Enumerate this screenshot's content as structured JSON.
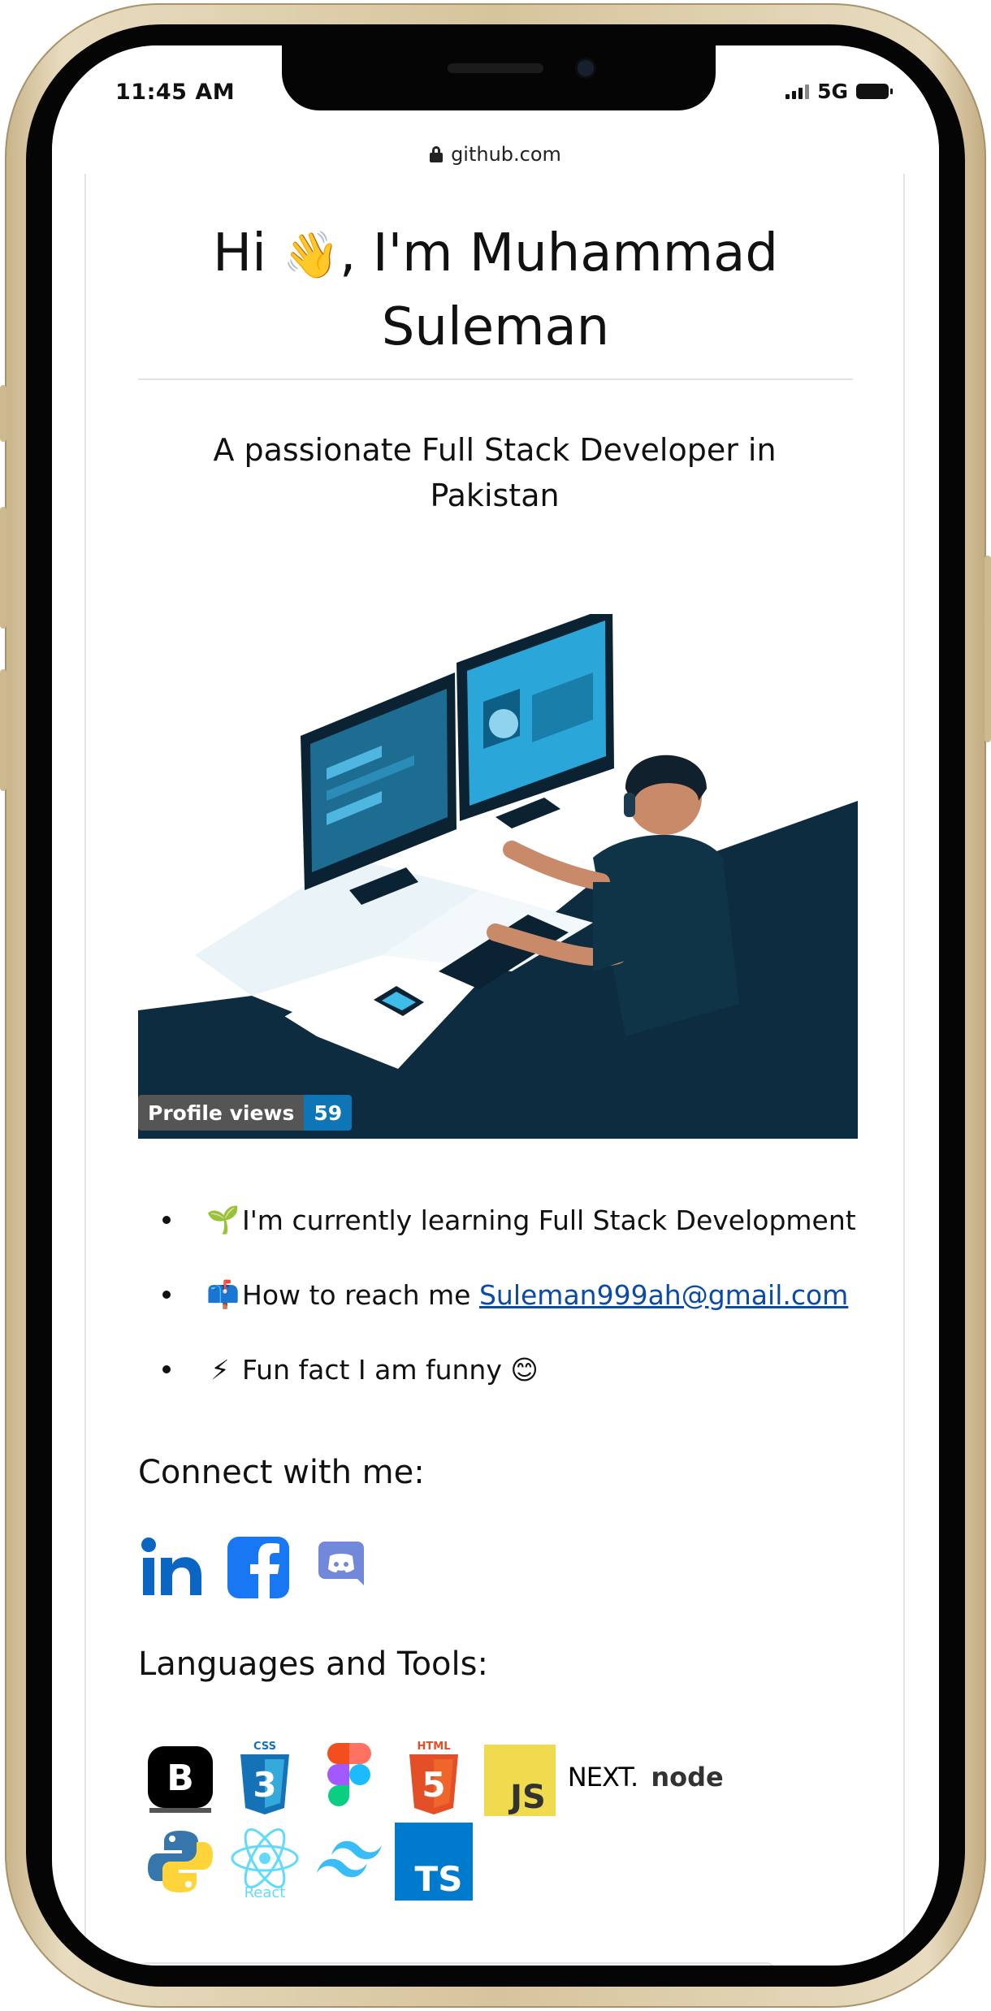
{
  "status": {
    "time": "11:45 AM",
    "network": "5G"
  },
  "browser": {
    "url": "github.com"
  },
  "profile": {
    "title_pre": "Hi ",
    "title_emoji": "👋",
    "title_post": ", I'm Muhammad Suleman",
    "subtitle": "A passionate Full Stack Developer in Pakistan"
  },
  "badge": {
    "label": "Profile views",
    "value": "59"
  },
  "facts": [
    {
      "emoji": "🌱",
      "text": "I'm currently learning Full Stack Development"
    },
    {
      "emoji": "📫",
      "text": "How to reach me ",
      "link": "Suleman999ah@gmail.com"
    },
    {
      "emoji": "⚡",
      "text": "Fun fact I am funny ",
      "emoji_after": "😊"
    }
  ],
  "connect": {
    "heading": "Connect with me:",
    "icons": [
      "linkedin-icon",
      "facebook-icon",
      "discord-icon"
    ]
  },
  "tools": {
    "heading": "Languages and Tools:",
    "icons": [
      "bootstrap-icon",
      "css3-icon",
      "figma-icon",
      "html5-icon",
      "javascript-icon",
      "nextjs-icon",
      "nodejs-icon",
      "python-icon",
      "react-icon",
      "tailwind-icon",
      "typescript-icon"
    ],
    "nextjs_text": "NEXT.",
    "node_text": "node",
    "js_text": "JS",
    "ts_text": "TS",
    "react_text": "React",
    "css_text": "CSS",
    "html_text": "HTML"
  },
  "colors": {
    "link": "#0b4aa8",
    "badge_value": "#0e75b6",
    "illustration_dark": "#0d2c40",
    "screen_blue": "#2aa6d8"
  }
}
